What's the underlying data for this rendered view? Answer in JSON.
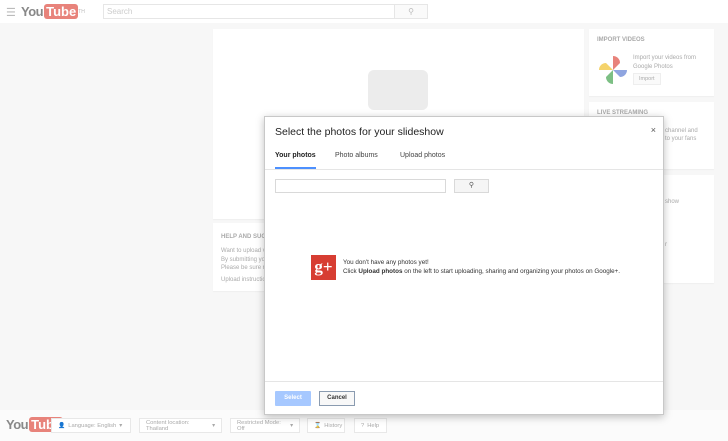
{
  "header": {
    "logo_you": "You",
    "logo_tube": "Tube",
    "logo_tm": "TH",
    "search_placeholder": "Search"
  },
  "import_videos": {
    "title": "IMPORT VIDEOS",
    "text": "Import your videos from Google Photos",
    "button": "Import"
  },
  "live_streaming": {
    "title": "LIVE STREAMING",
    "text_1": "channel and",
    "text_2": "to your fans"
  },
  "third_card": {
    "text_1": "show",
    "text_2": "r"
  },
  "help": {
    "title": "HELP AND SUGG",
    "lines": [
      "Want to upload v",
      "By submitting yo",
      "Please be sure n",
      "Upload instructio"
    ]
  },
  "dialog": {
    "title": "Select the photos for your slideshow",
    "close": "×",
    "tabs": [
      "Your photos",
      "Photo albums",
      "Upload photos"
    ],
    "search_icon": "🔍",
    "message_line1": "You don't have any photos yet!",
    "message_prefix": "Click ",
    "message_bold": "Upload photos",
    "message_suffix": " on the left to start uploading, sharing and organizing your photos on Google+.",
    "gplus": "g+",
    "select": "Select",
    "cancel": "Cancel"
  },
  "footer": {
    "language": "Language: English",
    "location": "Content location: Thailand",
    "restricted": "Restricted Mode: Off",
    "history": "History",
    "help": "Help"
  }
}
